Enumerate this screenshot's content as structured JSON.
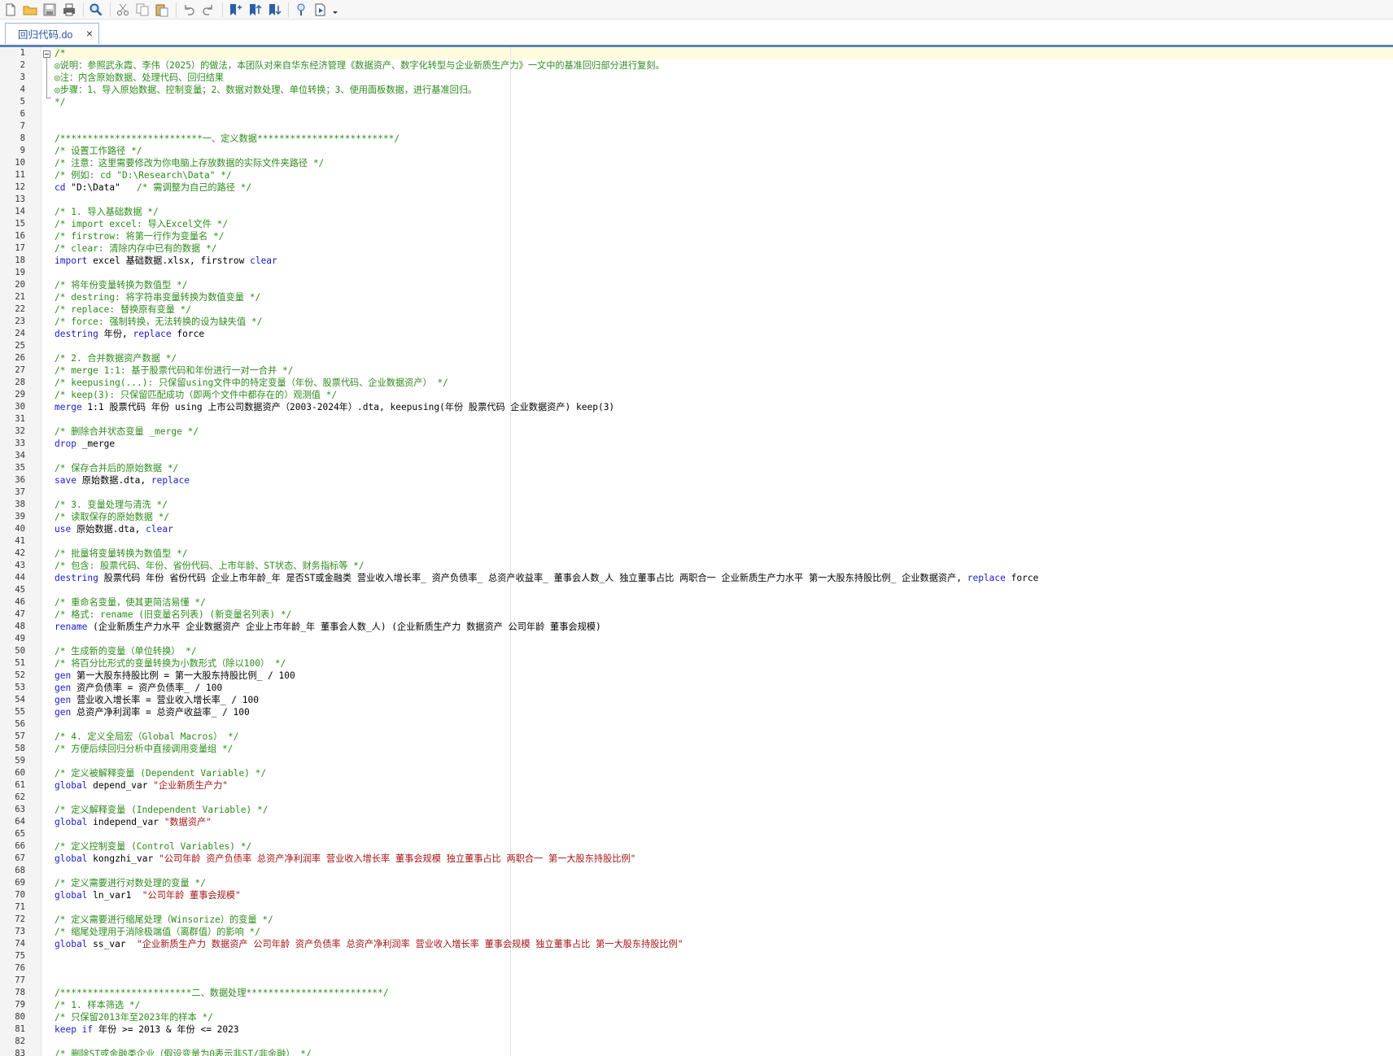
{
  "toolbar": {
    "buttons": [
      {
        "name": "new-file-icon"
      },
      {
        "name": "open-folder-icon"
      },
      {
        "name": "save-icon"
      },
      {
        "name": "print-icon"
      },
      {
        "name": "find-icon"
      },
      {
        "name": "cut-icon"
      },
      {
        "name": "copy-icon"
      },
      {
        "name": "paste-icon"
      },
      {
        "name": "undo-icon"
      },
      {
        "name": "redo-icon"
      },
      {
        "name": "toggle-bookmark-icon"
      },
      {
        "name": "previous-bookmark-icon"
      },
      {
        "name": "next-bookmark-icon"
      },
      {
        "name": "show-hints-icon"
      },
      {
        "name": "execute-do-icon"
      },
      {
        "name": "execute-dropdown-icon"
      }
    ]
  },
  "tab": {
    "label": "回归代码.do",
    "close": "×"
  },
  "colors": {
    "comment": "#2e8b1d",
    "keyword": "#1b1bc8",
    "string": "#a31515",
    "accent": "#5b82b4"
  },
  "code_lines": [
    {
      "n": "1",
      "tokens": [
        [
          "c",
          "/*"
        ]
      ]
    },
    {
      "n": "2",
      "tokens": [
        [
          "c",
          "◎说明：参照武永霞、李伟（2025）的做法，本团队对来自华东经济管理《数据资产、数字化转型与企业新质生产力》一文中的基准回归部分进行复刻。"
        ]
      ]
    },
    {
      "n": "3",
      "tokens": [
        [
          "c",
          "◎注：内含原始数据、处理代码、回归结果"
        ]
      ]
    },
    {
      "n": "4",
      "tokens": [
        [
          "c",
          "◎步骤：1、导入原始数据、控制变量；2、数据对数处理、单位转换；3、使用面板数据，进行基准回归。"
        ]
      ]
    },
    {
      "n": "5",
      "tokens": [
        [
          "c",
          "*/"
        ]
      ]
    },
    {
      "n": "6",
      "tokens": []
    },
    {
      "n": "7",
      "tokens": []
    },
    {
      "n": "8",
      "tokens": [
        [
          "c",
          "/**************************一、定义数据*************************/"
        ]
      ]
    },
    {
      "n": "9",
      "tokens": [
        [
          "c",
          "/* 设置工作路径 */"
        ]
      ]
    },
    {
      "n": "10",
      "tokens": [
        [
          "c",
          "/* 注意：这里需要修改为你电脑上存放数据的实际文件夹路径 */"
        ]
      ]
    },
    {
      "n": "11",
      "tokens": [
        [
          "c",
          "/* 例如: cd \"D:\\Research\\Data\" */"
        ]
      ]
    },
    {
      "n": "12",
      "tokens": [
        [
          "k",
          "cd "
        ],
        [
          "p",
          "\"D:\\Data\"   "
        ],
        [
          "c",
          "/* 需调整为自己的路径 */"
        ]
      ]
    },
    {
      "n": "13",
      "tokens": []
    },
    {
      "n": "14",
      "tokens": [
        [
          "c",
          "/* 1. 导入基础数据 */"
        ]
      ]
    },
    {
      "n": "15",
      "tokens": [
        [
          "c",
          "/* import excel: 导入Excel文件 */"
        ]
      ]
    },
    {
      "n": "16",
      "tokens": [
        [
          "c",
          "/* firstrow: 将第一行作为变量名 */"
        ]
      ]
    },
    {
      "n": "17",
      "tokens": [
        [
          "c",
          "/* clear: 清除内存中已有的数据 */"
        ]
      ]
    },
    {
      "n": "18",
      "tokens": [
        [
          "k",
          "import "
        ],
        [
          "p",
          "excel 基础数据.xlsx, firstrow "
        ],
        [
          "k",
          "clear"
        ]
      ]
    },
    {
      "n": "19",
      "tokens": []
    },
    {
      "n": "20",
      "tokens": [
        [
          "c",
          "/* 将年份变量转换为数值型 */"
        ]
      ]
    },
    {
      "n": "21",
      "tokens": [
        [
          "c",
          "/* destring: 将字符串变量转换为数值变量 */"
        ]
      ]
    },
    {
      "n": "22",
      "tokens": [
        [
          "c",
          "/* replace: 替换原有变量 */"
        ]
      ]
    },
    {
      "n": "23",
      "tokens": [
        [
          "c",
          "/* force: 强制转换，无法转换的设为缺失值 */"
        ]
      ]
    },
    {
      "n": "24",
      "tokens": [
        [
          "k",
          "destring "
        ],
        [
          "p",
          "年份, "
        ],
        [
          "k",
          "replace "
        ],
        [
          "p",
          "force"
        ]
      ]
    },
    {
      "n": "25",
      "tokens": []
    },
    {
      "n": "26",
      "tokens": [
        [
          "c",
          "/* 2. 合并数据资产数据 */"
        ]
      ]
    },
    {
      "n": "27",
      "tokens": [
        [
          "c",
          "/* merge 1:1: 基于股票代码和年份进行一对一合并 */"
        ]
      ]
    },
    {
      "n": "28",
      "tokens": [
        [
          "c",
          "/* keepusing(...): 只保留using文件中的特定变量（年份、股票代码、企业数据资产） */"
        ]
      ]
    },
    {
      "n": "29",
      "tokens": [
        [
          "c",
          "/* keep(3): 只保留匹配成功（即两个文件中都存在的）观测值 */"
        ]
      ]
    },
    {
      "n": "30",
      "tokens": [
        [
          "k",
          "merge "
        ],
        [
          "p",
          "1:1 股票代码 年份 using 上市公司数据资产（2003-2024年）.dta, keepusing(年份 股票代码 企业数据资产) keep(3)"
        ]
      ]
    },
    {
      "n": "31",
      "tokens": []
    },
    {
      "n": "32",
      "tokens": [
        [
          "c",
          "/* 删除合并状态变量 _merge */"
        ]
      ]
    },
    {
      "n": "33",
      "tokens": [
        [
          "k",
          "drop "
        ],
        [
          "p",
          "_merge"
        ]
      ]
    },
    {
      "n": "34",
      "tokens": []
    },
    {
      "n": "35",
      "tokens": [
        [
          "c",
          "/* 保存合并后的原始数据 */"
        ]
      ]
    },
    {
      "n": "36",
      "tokens": [
        [
          "k",
          "save "
        ],
        [
          "p",
          "原始数据.dta, "
        ],
        [
          "k",
          "replace"
        ]
      ]
    },
    {
      "n": "37",
      "tokens": []
    },
    {
      "n": "38",
      "tokens": [
        [
          "c",
          "/* 3. 变量处理与清洗 */"
        ]
      ]
    },
    {
      "n": "39",
      "tokens": [
        [
          "c",
          "/* 读取保存的原始数据 */"
        ]
      ]
    },
    {
      "n": "40",
      "tokens": [
        [
          "k",
          "use "
        ],
        [
          "p",
          "原始数据.dta, "
        ],
        [
          "k",
          "clear"
        ]
      ]
    },
    {
      "n": "41",
      "tokens": []
    },
    {
      "n": "42",
      "tokens": [
        [
          "c",
          "/* 批量将变量转换为数值型 */"
        ]
      ]
    },
    {
      "n": "43",
      "tokens": [
        [
          "c",
          "/* 包含: 股票代码、年份、省份代码、上市年龄、ST状态、财务指标等 */"
        ]
      ]
    },
    {
      "n": "44",
      "tokens": [
        [
          "k",
          "destring "
        ],
        [
          "p",
          "股票代码 年份 省份代码 企业上市年龄_年 是否ST或金融类 营业收入增长率_ 资产负债率_ 总资产收益率_ 董事会人数_人 独立董事占比 两职合一 企业新质生产力水平 第一大股东持股比例_ 企业数据资产, "
        ],
        [
          "k",
          "replace "
        ],
        [
          "p",
          "force"
        ]
      ]
    },
    {
      "n": "45",
      "tokens": []
    },
    {
      "n": "46",
      "tokens": [
        [
          "c",
          "/* 重命名变量，使其更简洁易懂 */"
        ]
      ]
    },
    {
      "n": "47",
      "tokens": [
        [
          "c",
          "/* 格式: rename (旧变量名列表) (新变量名列表) */"
        ]
      ]
    },
    {
      "n": "48",
      "tokens": [
        [
          "k",
          "rename "
        ],
        [
          "p",
          "(企业新质生产力水平 企业数据资产 企业上市年龄_年 董事会人数_人) (企业新质生产力 数据资产 公司年龄 董事会规模)"
        ]
      ]
    },
    {
      "n": "49",
      "tokens": []
    },
    {
      "n": "50",
      "tokens": [
        [
          "c",
          "/* 生成新的变量（单位转换） */"
        ]
      ]
    },
    {
      "n": "51",
      "tokens": [
        [
          "c",
          "/* 将百分比形式的变量转换为小数形式（除以100） */"
        ]
      ]
    },
    {
      "n": "52",
      "tokens": [
        [
          "k",
          "gen "
        ],
        [
          "p",
          "第一大股东持股比例 = 第一大股东持股比例_ / 100"
        ]
      ]
    },
    {
      "n": "53",
      "tokens": [
        [
          "k",
          "gen "
        ],
        [
          "p",
          "资产负债率 = 资产负债率_ / 100"
        ]
      ]
    },
    {
      "n": "54",
      "tokens": [
        [
          "k",
          "gen "
        ],
        [
          "p",
          "营业收入增长率 = 营业收入增长率_ / 100"
        ]
      ]
    },
    {
      "n": "55",
      "tokens": [
        [
          "k",
          "gen "
        ],
        [
          "p",
          "总资产净利润率 = 总资产收益率_ / 100"
        ]
      ]
    },
    {
      "n": "56",
      "tokens": []
    },
    {
      "n": "57",
      "tokens": [
        [
          "c",
          "/* 4. 定义全局宏（Global Macros） */"
        ]
      ]
    },
    {
      "n": "58",
      "tokens": [
        [
          "c",
          "/* 方便后续回归分析中直接调用变量组 */"
        ]
      ]
    },
    {
      "n": "59",
      "tokens": []
    },
    {
      "n": "60",
      "tokens": [
        [
          "c",
          "/* 定义被解释变量 (Dependent Variable) */"
        ]
      ]
    },
    {
      "n": "61",
      "tokens": [
        [
          "k",
          "global "
        ],
        [
          "p",
          "depend_var "
        ],
        [
          "s",
          "\"企业新质生产力\""
        ]
      ]
    },
    {
      "n": "62",
      "tokens": []
    },
    {
      "n": "63",
      "tokens": [
        [
          "c",
          "/* 定义解释变量 (Independent Variable) */"
        ]
      ]
    },
    {
      "n": "64",
      "tokens": [
        [
          "k",
          "global "
        ],
        [
          "p",
          "independ_var "
        ],
        [
          "s",
          "\"数据资产\""
        ]
      ]
    },
    {
      "n": "65",
      "tokens": []
    },
    {
      "n": "66",
      "tokens": [
        [
          "c",
          "/* 定义控制变量 (Control Variables) */"
        ]
      ]
    },
    {
      "n": "67",
      "tokens": [
        [
          "k",
          "global "
        ],
        [
          "p",
          "kongzhi_var "
        ],
        [
          "s",
          "\"公司年龄 资产负债率 总资产净利润率 营业收入增长率 董事会规模 独立董事占比 两职合一 第一大股东持股比例\""
        ]
      ]
    },
    {
      "n": "68",
      "tokens": []
    },
    {
      "n": "69",
      "tokens": [
        [
          "c",
          "/* 定义需要进行对数处理的变量 */"
        ]
      ]
    },
    {
      "n": "70",
      "tokens": [
        [
          "k",
          "global "
        ],
        [
          "p",
          "ln_var1  "
        ],
        [
          "s",
          "\"公司年龄 董事会规模\""
        ]
      ]
    },
    {
      "n": "71",
      "tokens": []
    },
    {
      "n": "72",
      "tokens": [
        [
          "c",
          "/* 定义需要进行缩尾处理（Winsorize）的变量 */"
        ]
      ]
    },
    {
      "n": "73",
      "tokens": [
        [
          "c",
          "/* 缩尾处理用于消除极端值（离群值）的影响 */"
        ]
      ]
    },
    {
      "n": "74",
      "tokens": [
        [
          "k",
          "global "
        ],
        [
          "p",
          "ss_var  "
        ],
        [
          "s",
          "\"企业新质生产力 数据资产 公司年龄 资产负债率 总资产净利润率 营业收入增长率 董事会规模 独立董事占比 第一大股东持股比例\""
        ]
      ]
    },
    {
      "n": "75",
      "tokens": []
    },
    {
      "n": "76",
      "tokens": []
    },
    {
      "n": "77",
      "tokens": []
    },
    {
      "n": "78",
      "tokens": [
        [
          "c",
          "/************************二、数据处理*************************/"
        ]
      ]
    },
    {
      "n": "79",
      "tokens": [
        [
          "c",
          "/* 1. 样本筛选 */"
        ]
      ]
    },
    {
      "n": "80",
      "tokens": [
        [
          "c",
          "/* 只保留2013年至2023年的样本 */"
        ]
      ]
    },
    {
      "n": "81",
      "tokens": [
        [
          "k",
          "keep if "
        ],
        [
          "p",
          "年份 >= 2013 & 年份 <= 2023"
        ]
      ]
    },
    {
      "n": "82",
      "tokens": []
    },
    {
      "n": "83",
      "tokens": [
        [
          "c",
          "/* 删除ST或金融类企业（假设变量为0表示非ST/非金融） */"
        ]
      ]
    }
  ]
}
